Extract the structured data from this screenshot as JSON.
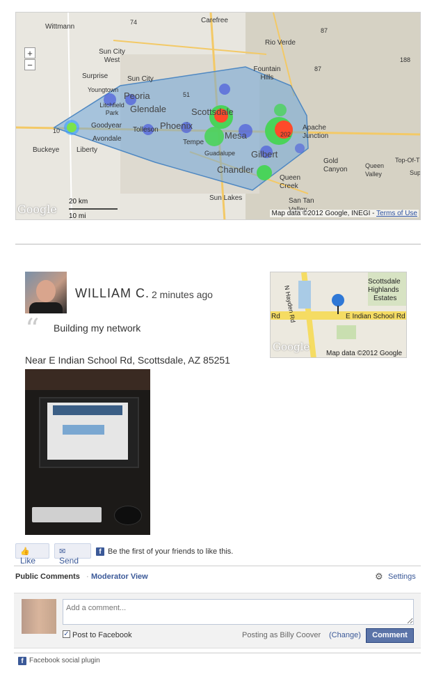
{
  "heatmap": {
    "zoom_in": "+",
    "zoom_out": "−",
    "places": [
      "Wittmann",
      "Carefree",
      "Rio Verde",
      "Sun City West",
      "Sun City",
      "Surprise",
      "Youngtown",
      "Peoria",
      "Fountain Hills",
      "Litchfield Park",
      "Glendale",
      "Scottsdale",
      "Goodyear",
      "Tolleson",
      "Phoenix",
      "Mesa",
      "Apache Junction",
      "Avondale",
      "Tempe",
      "Guadalupe",
      "Gilbert",
      "Buckeye",
      "Liberty",
      "Chandler",
      "Gold Canyon",
      "Queen Valley",
      "Top-Of-The",
      "Sup",
      "Queen Creek",
      "Sun Lakes",
      "San Tan Valley"
    ],
    "highways": [
      "74",
      "87",
      "87",
      "188",
      "51",
      "10",
      "202"
    ],
    "scale_km": "20 km",
    "scale_mi": "10 mi",
    "google": "Google",
    "attribution": "Map data ©2012 Google, INEGI - ",
    "terms": "Terms of Use"
  },
  "post": {
    "username": "WILLIAM C.",
    "time": "2 minutes ago",
    "quote_mark": "“",
    "status": "Building my network",
    "location": "Near E Indian School Rd, Scottsdale, AZ 85251"
  },
  "minimap": {
    "labels": [
      "Scottsdale",
      "Highlands",
      "Estates",
      "Rd",
      "E Indian School Rd",
      "N Hayden Rd"
    ],
    "google": "Google",
    "attribution": "Map data ©2012 Google"
  },
  "like_bar": {
    "like": "Like",
    "send": "Send",
    "fb": "f",
    "text": "Be the first of your friends to like this."
  },
  "comments": {
    "tab_public": "Public Comments",
    "tab_sep": "·",
    "tab_moderator": "Moderator View",
    "settings": "Settings",
    "placeholder": "Add a comment...",
    "checkbox_mark": "✓",
    "post_to_fb": "Post to Facebook",
    "posting_as": "Posting as Billy Coover",
    "change": "(Change)",
    "button": "Comment",
    "plugin": "Facebook social plugin"
  },
  "colors": {
    "fb_blue": "#3b5998",
    "heat_polygon": "#6fa6d8"
  }
}
